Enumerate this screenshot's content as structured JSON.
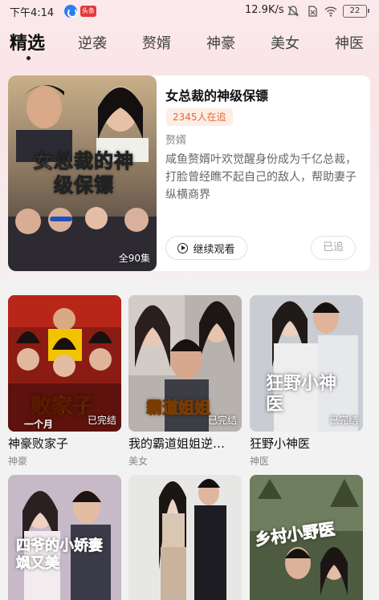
{
  "status_bar": {
    "time": "下午4:14",
    "app2_badge": "头条",
    "net_speed": "12.9K/s",
    "battery": "22"
  },
  "tabs": [
    {
      "label": "精选",
      "active": true
    },
    {
      "label": "逆袭"
    },
    {
      "label": "赘婿"
    },
    {
      "label": "神豪"
    },
    {
      "label": "美女"
    },
    {
      "label": "神医"
    }
  ],
  "featured": {
    "title": "女总裁的神级保镖",
    "followers": "2345人在追",
    "genre": "赘婿",
    "description": "咸鱼赘婿叶欢觉醒身份成为千亿总裁，打脸曾经瞧不起自己的敌人，帮助妻子纵横商界",
    "poster_text": "女总裁的神级保镖",
    "poster_episodes": "全90集",
    "continue_label": "继续观看",
    "followed_label": "已追"
  },
  "grid": [
    {
      "title": "神豪败家子",
      "genre": "神豪",
      "status": "已完结",
      "poster_text": "败家子",
      "poster_sub": "一个月"
    },
    {
      "title": "我的霸道姐姐逆…",
      "genre": "美女",
      "status": "已完结",
      "poster_text": "霸道姐姐"
    },
    {
      "title": "狂野小神医",
      "genre": "神医",
      "status": "已完结",
      "poster_text": "狂野小神医"
    }
  ],
  "bottom_row": [
    {
      "poster_text": "四爷的小娇妻飒又美"
    },
    {
      "poster_text": ""
    },
    {
      "poster_text": "乡村小野医"
    }
  ]
}
